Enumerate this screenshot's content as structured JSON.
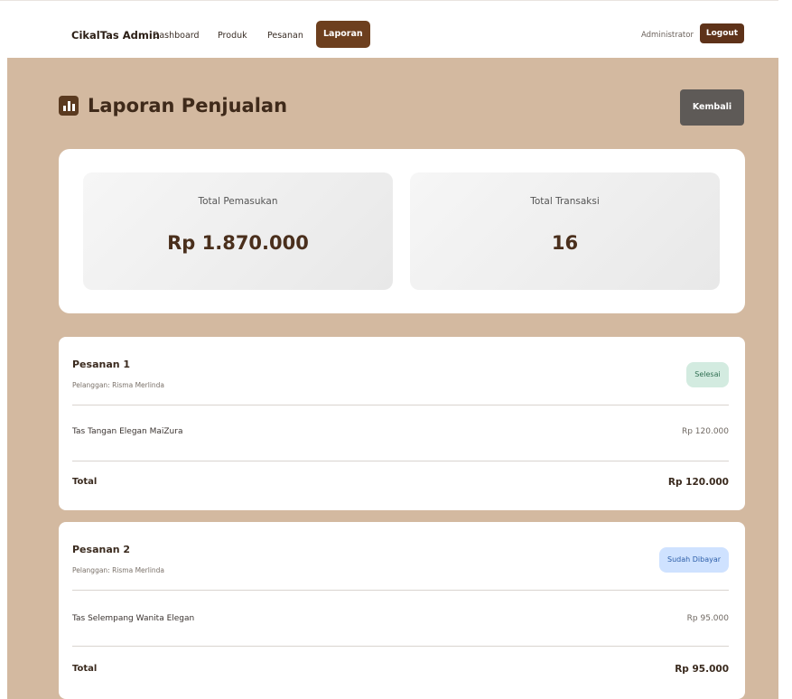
{
  "navbar": {
    "brand": "CikalTas Admin",
    "links": [
      "Dashboard",
      "Produk",
      "Pesanan",
      "Laporan"
    ],
    "active_link": "Laporan",
    "user": "Administrator",
    "logout_label": "Logout"
  },
  "header": {
    "title": "Laporan Penjualan",
    "back_label": "Kembali"
  },
  "summary": {
    "income_label": "Total Pemasukan",
    "income_value": "Rp 1.870.000",
    "transactions_label": "Total Transaksi",
    "transactions_value": "16"
  },
  "orders": [
    {
      "title": "Pesanan 1",
      "customer": "Pelanggan: Risma Merlinda",
      "status": "Selesai",
      "items": [
        {
          "name": "Tas Tangan Elegan MaiZura",
          "price": "Rp 120.000"
        }
      ],
      "total_label": "Total",
      "total": "Rp 120.000"
    },
    {
      "title": "Pesanan 2",
      "customer": "Pelanggan: Risma Merlinda",
      "status": "Sudah Dibayar",
      "items": [
        {
          "name": "Tas Selempang Wanita Elegan",
          "price": "Rp 95.000"
        }
      ],
      "total_label": "Total",
      "total": "Rp 95.000"
    }
  ],
  "colors": {
    "brand_brown": "#6d3f1e",
    "background_beige": "#d3b9a0",
    "status_done_bg": "#d3ebe0",
    "status_paid_bg": "#cfe2ff"
  },
  "icons": {
    "header_icon": "bar-chart-icon"
  }
}
